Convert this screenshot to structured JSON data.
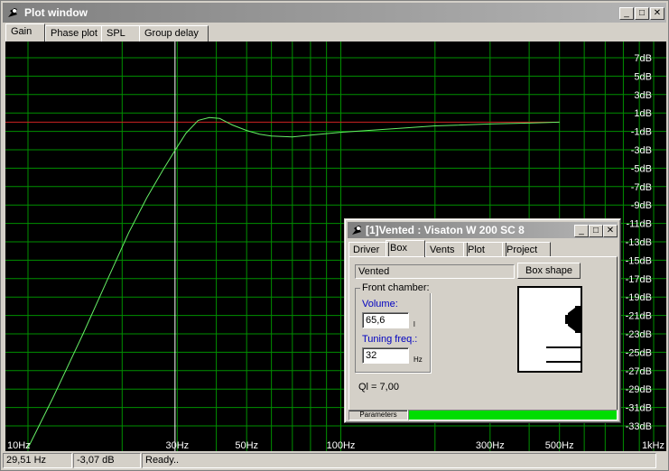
{
  "window": {
    "title": "Plot window"
  },
  "tabs": [
    "Gain",
    "Phase plot",
    "SPL",
    "Group delay"
  ],
  "active_tab": "Gain",
  "plot": {
    "y_labels": [
      "7dB",
      "5dB",
      "3dB",
      "1dB",
      "-1dB",
      "-3dB",
      "-5dB",
      "-7dB",
      "-9dB",
      "-11dB",
      "-13dB",
      "-15dB",
      "-17dB",
      "-19dB",
      "-21dB",
      "-23dB",
      "-25dB",
      "-27dB",
      "-29dB",
      "-31dB",
      "-33dB"
    ],
    "x_labels": [
      {
        "text": "10Hz",
        "f": 10
      },
      {
        "text": "30Hz",
        "f": 30
      },
      {
        "text": "50Hz",
        "f": 50
      },
      {
        "text": "100Hz",
        "f": 100
      },
      {
        "text": "300Hz",
        "f": 300
      },
      {
        "text": "500Hz",
        "f": 500
      },
      {
        "text": "1kHz",
        "f": 1000
      }
    ],
    "cursor_freq": 29.51,
    "reference_level_db": 0,
    "response": [
      [
        10,
        -35.4
      ],
      [
        12,
        -30
      ],
      [
        15,
        -23
      ],
      [
        18,
        -17
      ],
      [
        21,
        -12
      ],
      [
        24,
        -8.2
      ],
      [
        27,
        -5.2
      ],
      [
        29.51,
        -3.07
      ],
      [
        32,
        -1.2
      ],
      [
        35,
        0.2
      ],
      [
        38,
        0.5
      ],
      [
        41,
        0.4
      ],
      [
        45,
        -0.3
      ],
      [
        50,
        -0.9
      ],
      [
        55,
        -1.3
      ],
      [
        60,
        -1.5
      ],
      [
        70,
        -1.6
      ],
      [
        80,
        -1.4
      ],
      [
        100,
        -1.1
      ],
      [
        150,
        -0.7
      ],
      [
        200,
        -0.4
      ],
      [
        300,
        -0.2
      ],
      [
        400,
        -0.1
      ],
      [
        500,
        0
      ]
    ],
    "colors": {
      "grid": "#009000",
      "response": "#66ee66",
      "reference": "#cc2222",
      "cursor": "#ffffff",
      "label": "#ffffff"
    }
  },
  "status": {
    "freq": "29,51 Hz",
    "gain": "-3,07 dB",
    "message": "Ready.."
  },
  "sub": {
    "title": "[1]Vented : Visaton W 200 SC 8",
    "tabs": [
      "Driver",
      "Box",
      "Vents",
      "Plot",
      "Project"
    ],
    "active_tab": "Box",
    "box_type": "Vented",
    "box_shape_label": "Box shape",
    "front_chamber_label": "Front chamber:",
    "volume_label": "Volume:",
    "volume_value": "65,6",
    "volume_unit": "l",
    "tuning_label": "Tuning freq.:",
    "tuning_value": "32",
    "tuning_unit": "Hz",
    "ql_text": "Ql = 7,00",
    "progress_label": "Parameters",
    "progress_fraction": 1.0
  }
}
